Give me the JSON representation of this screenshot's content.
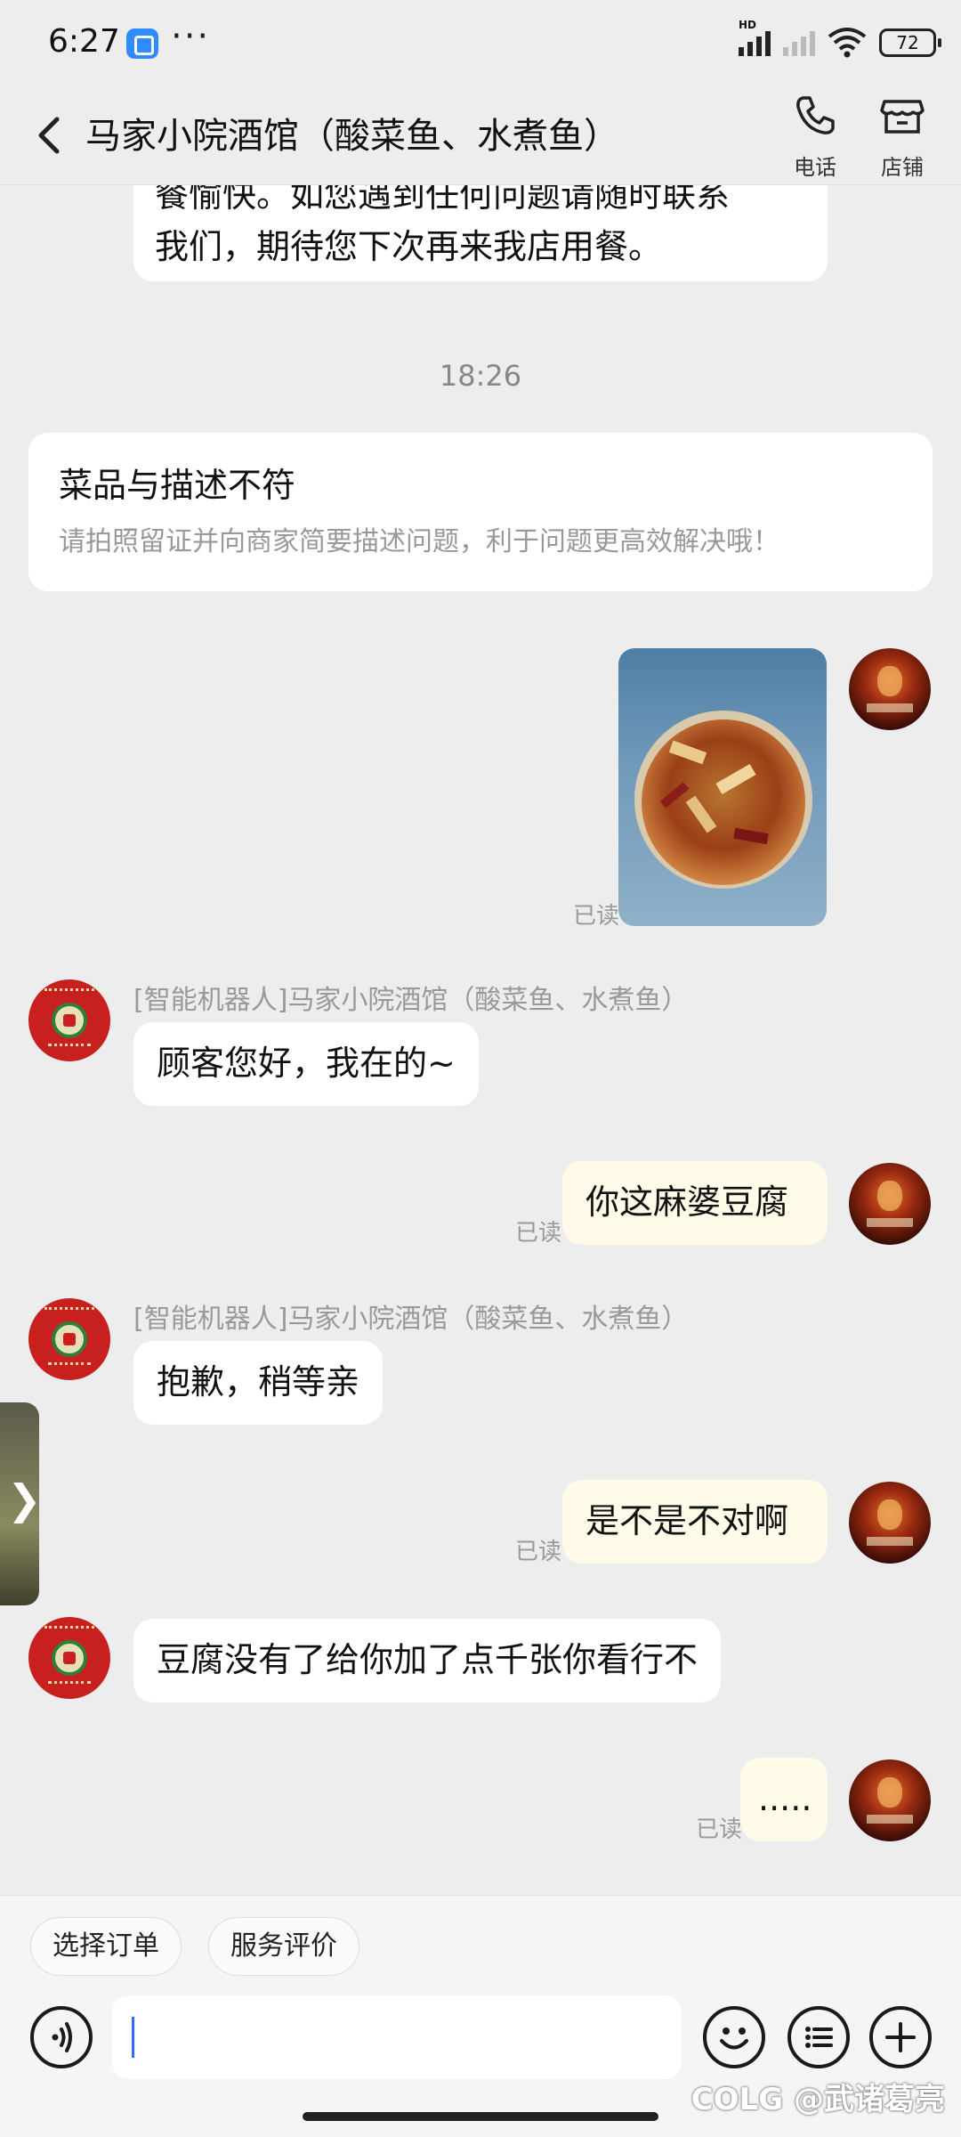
{
  "status_bar": {
    "time": "6:27",
    "more": "···",
    "hd": "HD",
    "battery": "72"
  },
  "header": {
    "title": "马家小院酒馆（酸菜鱼、水煮鱼）",
    "phone_label": "电话",
    "shop_label": "店铺"
  },
  "messages": {
    "top_bubble_partial": "餐愉快。如您遇到任何问题请随时联系",
    "top_bubble_line2": "我们，期待您下次再来我店用餐。",
    "timestamp": "18:26",
    "complaint_card": {
      "title": "菜品与描述不符",
      "subtitle": "请拍照留证并向商家简要描述问题，利于问题更高效解决哦！"
    },
    "read_label": "已读",
    "sender_name": "[智能机器人]马家小院酒馆（酸菜鱼、水煮鱼）",
    "m1": "顾客您好，我在的~",
    "m2": "你这麻婆豆腐",
    "m3": "抱歉，稍等亲",
    "m4": "是不是不对啊",
    "m5": "豆腐没有了给你加了点千张你看行不",
    "m6": "....."
  },
  "bottom": {
    "chip_order": "选择订单",
    "chip_review": "服务评价",
    "input_value": ""
  },
  "watermark": "COLG @武诸葛亮",
  "colors": {
    "background": "#ededed",
    "my_bubble": "#fffbe8",
    "other_bubble": "#ffffff",
    "shop_avatar": "#c8201f",
    "caret": "#2f6bff"
  }
}
